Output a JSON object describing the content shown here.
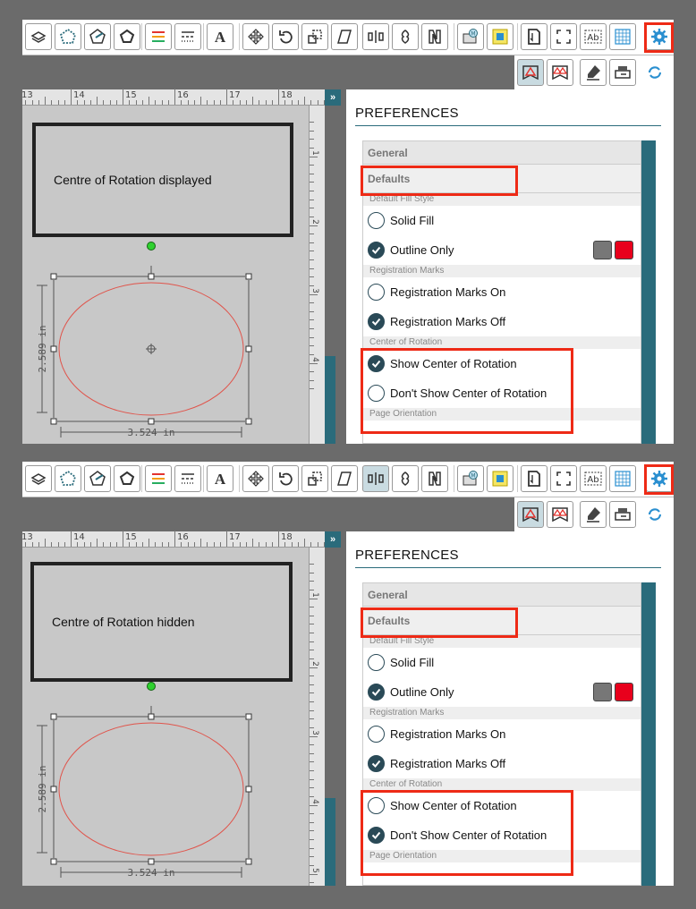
{
  "panels": [
    {
      "caption": "Centre of Rotation displayed",
      "show_center_marker": true,
      "dimensions": {
        "height": "2.589 in",
        "width": "3.524 in"
      },
      "ruler_labels": [
        "13",
        "14",
        "15",
        "16",
        "17",
        "18"
      ],
      "vruler_labels": [
        "1",
        "2",
        "3",
        "4"
      ],
      "preferences": {
        "title": "PREFERENCES",
        "general": "General",
        "defaults": "Defaults",
        "sections": [
          {
            "label": "Default Fill Style",
            "options": [
              {
                "label": "Solid Fill",
                "selected": false
              },
              {
                "label": "Outline Only",
                "selected": true
              }
            ]
          },
          {
            "label": "Registration Marks",
            "options": [
              {
                "label": "Registration Marks On",
                "selected": false
              },
              {
                "label": "Registration Marks Off",
                "selected": true
              }
            ]
          },
          {
            "label": "Center of Rotation",
            "options": [
              {
                "label": "Show Center of Rotation",
                "selected": true
              },
              {
                "label": "Don't Show Center of Rotation",
                "selected": false
              }
            ]
          }
        ],
        "next_section": "Page Orientation"
      }
    },
    {
      "caption": "Centre of Rotation hidden",
      "show_center_marker": false,
      "dimensions": {
        "height": "2.589 in",
        "width": "3.524 in"
      },
      "ruler_labels": [
        "13",
        "14",
        "15",
        "16",
        "17",
        "18"
      ],
      "vruler_labels": [
        "1",
        "2",
        "3",
        "4",
        "5"
      ],
      "preferences": {
        "title": "PREFERENCES",
        "general": "General",
        "defaults": "Defaults",
        "sections": [
          {
            "label": "Default Fill Style",
            "options": [
              {
                "label": "Solid Fill",
                "selected": false
              },
              {
                "label": "Outline Only",
                "selected": true
              }
            ]
          },
          {
            "label": "Registration Marks",
            "options": [
              {
                "label": "Registration Marks On",
                "selected": false
              },
              {
                "label": "Registration Marks Off",
                "selected": true
              }
            ]
          },
          {
            "label": "Center of Rotation",
            "options": [
              {
                "label": "Show Center of Rotation",
                "selected": false
              },
              {
                "label": "Don't Show Center of Rotation",
                "selected": true
              }
            ]
          }
        ],
        "next_section": "Page Orientation"
      }
    }
  ],
  "toolbar": {
    "icons": [
      "layers-icon",
      "polygon-icon",
      "star-shape-icon",
      "pentagon-icon",
      "line-style-icon",
      "dashed-line-icon",
      "text-icon",
      "move-icon",
      "rotate-icon",
      "scale-icon",
      "skew-icon",
      "align-icon",
      "replicate-icon",
      "knife-icon",
      "media-icon",
      "trace-icon",
      "page-setup-icon",
      "zoom-fit-icon",
      "font-icon",
      "grid-icon",
      "settings-gear-icon"
    ],
    "secondary_icons": [
      "cut-settings-icon",
      "registration-marks-icon",
      "eraser-icon",
      "send-icon",
      "sync-icon"
    ]
  },
  "colors": {
    "accent": "#2a6b7b",
    "highlight": "#ee2a16",
    "swatch_fill": "#777777",
    "swatch_line": "#e8001c",
    "ellipse": "#e0534a"
  },
  "labels": {
    "collapse": "»"
  }
}
